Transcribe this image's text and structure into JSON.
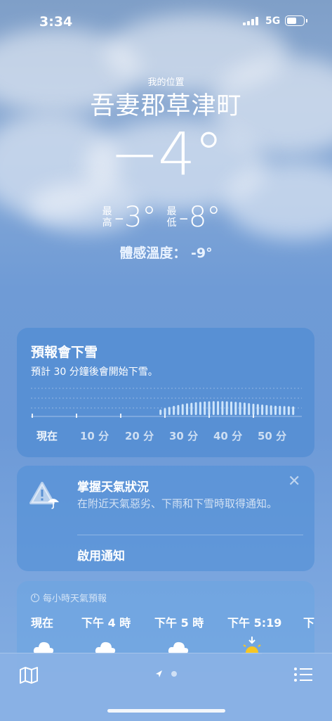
{
  "status_bar": {
    "time": "3:34",
    "network": "5G",
    "battery_fraction": 0.6
  },
  "header": {
    "my_location": "我的位置",
    "city": "吾妻郡草津町",
    "temperature": "−4°",
    "high_label": "最高",
    "high": "-3°",
    "low_label": "最低",
    "low": "-8°",
    "feels_like": "體感溫度： -9°"
  },
  "precip_card": {
    "title": "預報會下雪",
    "subtitle": "預計 30 分鐘後會開始下雪。",
    "time_labels": [
      "現在",
      "10 分",
      "20 分",
      "30 分",
      "40 分",
      "50 分"
    ],
    "intensity": [
      0,
      0,
      0,
      0,
      0,
      0,
      0,
      0,
      0,
      0,
      0,
      0,
      0,
      0,
      0,
      0,
      0,
      0,
      0,
      0,
      0,
      0,
      0,
      0,
      0,
      0,
      0,
      0,
      0,
      0.3,
      0.38,
      0.44,
      0.5,
      0.55,
      0.6,
      0.64,
      0.67,
      0.7,
      0.72,
      0.74,
      0.75,
      0.76,
      0.76,
      0.76,
      0.75,
      0.74,
      0.72,
      0.7,
      0.68,
      0.65,
      0.62,
      0.6,
      0.57,
      0.55,
      0.53,
      0.51,
      0.5,
      0.49,
      0.48,
      0.47
    ]
  },
  "notification_card": {
    "title": "掌握天氣狀況",
    "body": "在附近天氣惡劣、下雨和下雪時取得通知。",
    "action": "啟用通知",
    "close": "✕"
  },
  "hourly_card": {
    "heading": "每小時天氣預報",
    "hours": [
      {
        "label": "現在",
        "icon": "cloud-icon"
      },
      {
        "label": "下午 4 時",
        "icon": "cloud-icon"
      },
      {
        "label": "下午 5 時",
        "icon": "cloud-icon"
      },
      {
        "label": "下午 5:19",
        "icon": "sunset-icon"
      },
      {
        "label": "下",
        "icon": "cloud-icon"
      }
    ]
  },
  "toolbar": {
    "page_count": 2,
    "current_page": 0
  },
  "colors": {
    "card": "#508CD2",
    "background_top": "#7f9fc8",
    "background_bottom": "#86b0e3"
  }
}
